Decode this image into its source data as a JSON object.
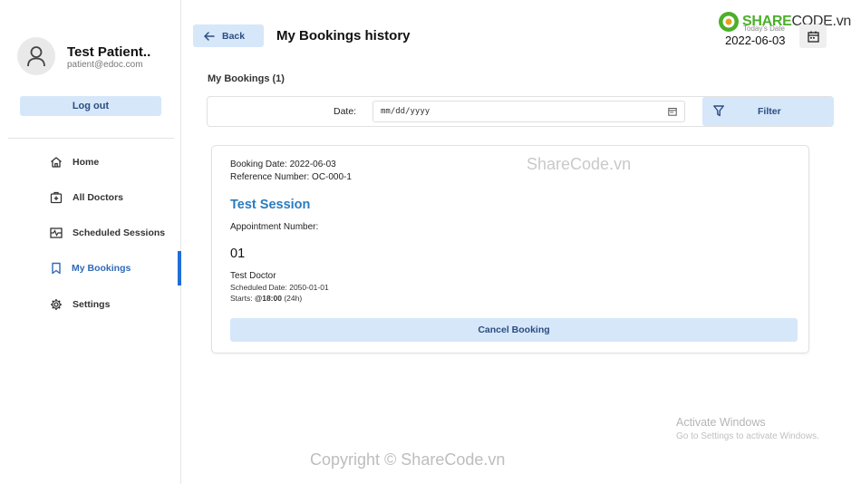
{
  "profile": {
    "name": "Test Patient..",
    "email": "patient@edoc.com",
    "logout_label": "Log out"
  },
  "sidebar": {
    "items": [
      {
        "label": "Home",
        "icon": "home-icon",
        "active": false
      },
      {
        "label": "All Doctors",
        "icon": "doctor-icon",
        "active": false
      },
      {
        "label": "Scheduled Sessions",
        "icon": "schedule-icon",
        "active": false
      },
      {
        "label": "My Bookings",
        "icon": "bookmark-icon",
        "active": true
      },
      {
        "label": "Settings",
        "icon": "gear-icon",
        "active": false
      }
    ]
  },
  "header": {
    "back_label": "Back",
    "title": "My Bookings history",
    "today_label": "Today's Date",
    "today_date": "2022-06-03"
  },
  "logo": {
    "brand": "SHARE",
    "brand_tail": "CODE.vn"
  },
  "bookings": {
    "count_label": "My Bookings (1)",
    "filter": {
      "date_label": "Date:",
      "date_placeholder": "mm/dd/yyyy",
      "filter_label": "Filter"
    },
    "card": {
      "booking_date": "Booking Date: 2022-06-03",
      "reference": "Reference Number: OC-000-1",
      "session_title": "Test Session",
      "appointment_label": "Appointment Number:",
      "appointment_number": "01",
      "doctor": "Test Doctor",
      "scheduled_date": "Scheduled Date: 2050-01-01",
      "starts_prefix": "Starts: ",
      "starts_time": "@18:00",
      "starts_suffix": " (24h)",
      "cancel_label": "Cancel Booking"
    }
  },
  "watermarks": {
    "center": "ShareCode.vn",
    "copyright": "Copyright © ShareCode.vn",
    "windows_title": "Activate Windows",
    "windows_sub": "Go to Settings to activate Windows."
  },
  "colors": {
    "accent": "#1f6fd6",
    "button_bg": "#d6e7fa",
    "button_text": "#2b4d80",
    "session_title": "#2a7bc0"
  }
}
